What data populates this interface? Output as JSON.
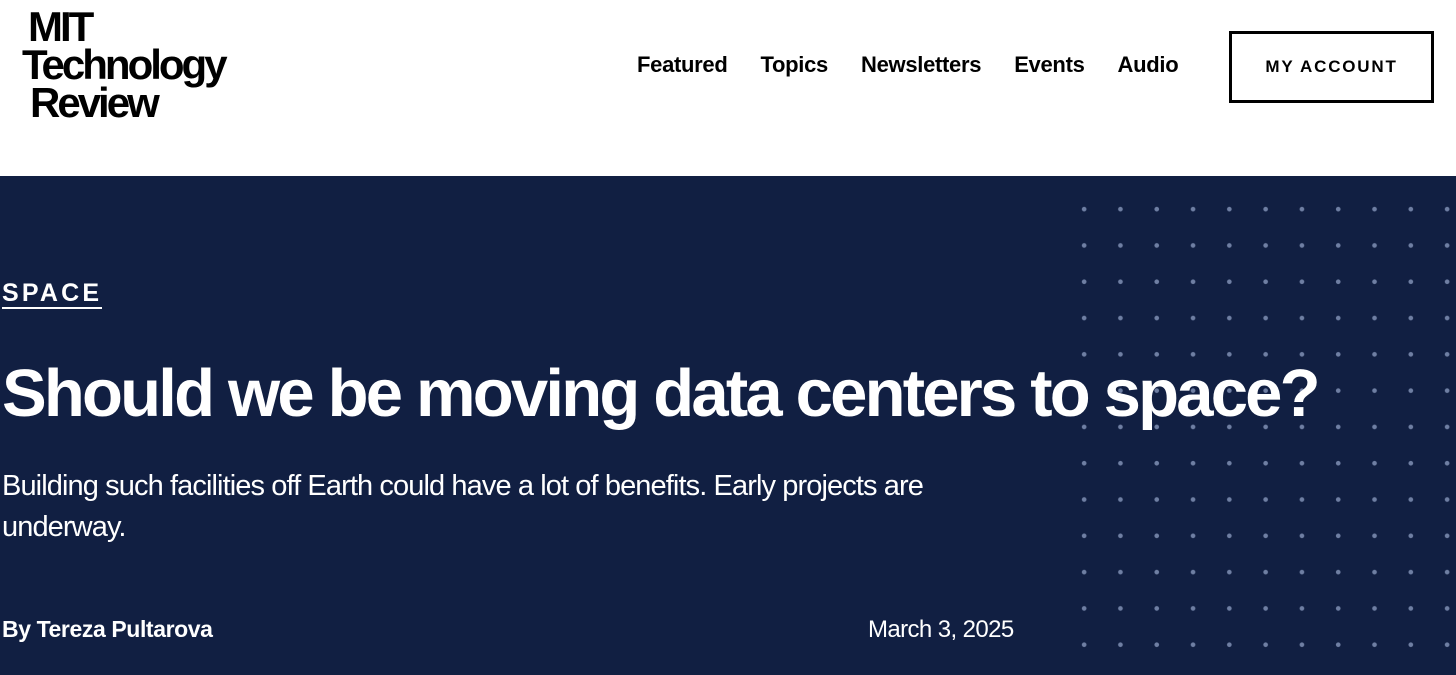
{
  "header": {
    "logo": {
      "line1": "MIT",
      "line2": "Technology",
      "line3": "Review"
    },
    "nav": [
      {
        "label": "Featured"
      },
      {
        "label": "Topics"
      },
      {
        "label": "Newsletters"
      },
      {
        "label": "Events"
      },
      {
        "label": "Audio"
      }
    ],
    "account_button": "MY ACCOUNT"
  },
  "article": {
    "category": "SPACE",
    "headline": "Should we be moving data centers to space?",
    "dek": "Building such facilities off Earth could have a lot of benefits. Early projects are underway.",
    "byline_prefix": "By ",
    "author": "Tereza Pultarova",
    "date": "March 3, 2025"
  },
  "colors": {
    "hero_background": "#111f42",
    "dot_pattern": "#6f7fa3",
    "header_background": "#ffffff",
    "text_dark": "#000000",
    "text_light": "#ffffff"
  }
}
